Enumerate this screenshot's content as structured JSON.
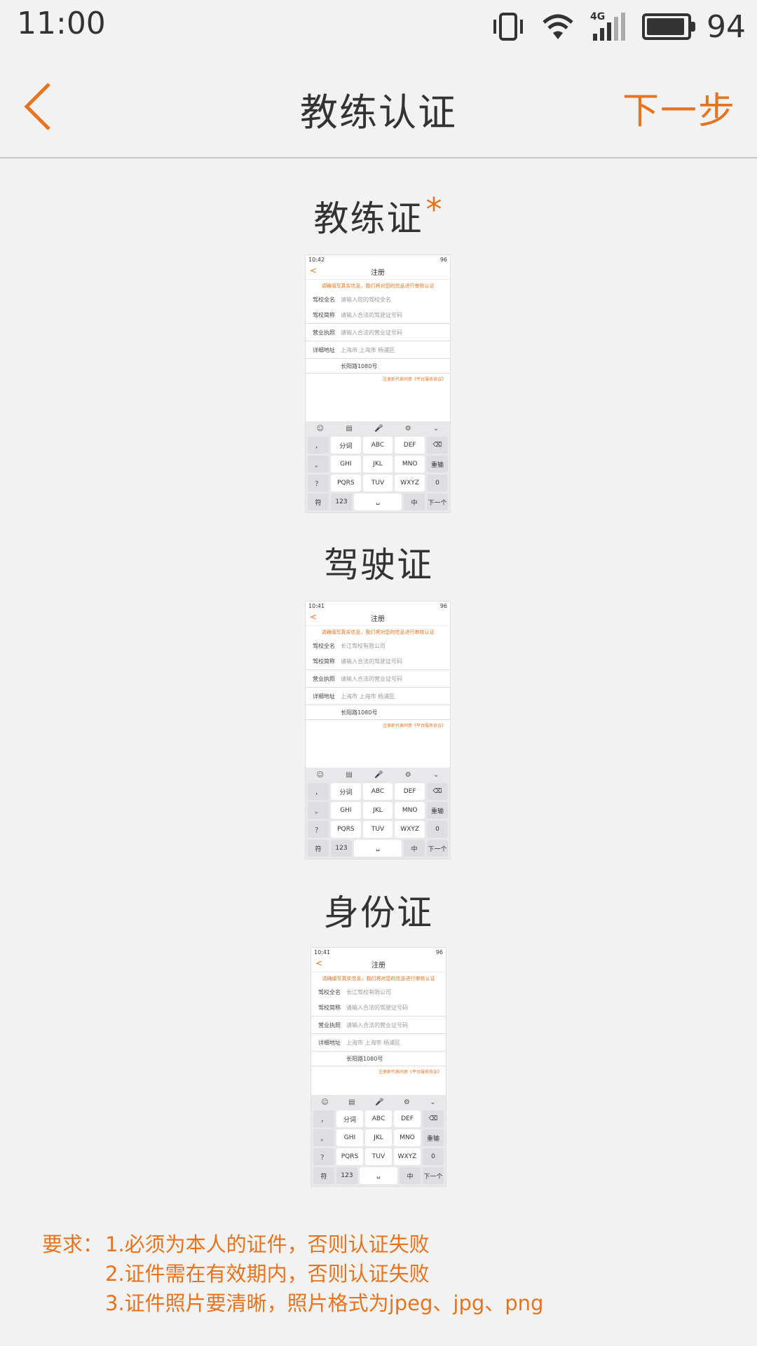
{
  "status_bar": {
    "time": "11:00",
    "network": "4G",
    "battery": "94",
    "battery_level": 0.94
  },
  "nav": {
    "title": "教练认证",
    "next_label": "下一步"
  },
  "sections": [
    {
      "title": "教练证",
      "required_mark": "*"
    },
    {
      "title": "驾驶证"
    },
    {
      "title": "身份证"
    }
  ],
  "thumbnails": [
    {
      "time": "10:42",
      "battery": "96",
      "title": "注册",
      "notice": "请确填写真实信息，我们将对您的信息进行审核认证",
      "rows": [
        {
          "label": "驾校全名",
          "value": "请输入您的驾校全名"
        },
        {
          "label": "驾校简称",
          "value": "请输入合法的驾驶证号码"
        },
        {
          "label": "营业执照",
          "value": "请输入合法的营业证号码"
        },
        {
          "label": "详细地址",
          "value": "上海市 上海市 杨浦区"
        }
      ],
      "addr2": "长阳路1080号",
      "terms": "注册即代表同意《平台服务协议》",
      "keys": {
        "top": [
          "☺",
          "▤",
          "🎤",
          "⚙",
          "⌄"
        ],
        "side": [
          "，",
          "。",
          "？",
          "！"
        ],
        "rows": [
          [
            "分词",
            "ABC",
            "DEF"
          ],
          [
            "GHI",
            "JKL",
            "MNO"
          ],
          [
            "PQRS",
            "TUV",
            "WXYZ"
          ]
        ],
        "right": [
          "⌫",
          "重输",
          "0"
        ],
        "bottom": [
          "符",
          "123",
          "␣",
          "中",
          "下一个"
        ]
      }
    },
    {
      "time": "10:41",
      "battery": "96",
      "title": "注册",
      "notice": "请确填写真实信息，我们将对您的信息进行审核认证",
      "rows": [
        {
          "label": "驾校全名",
          "value": "长江驾校有限公司"
        },
        {
          "label": "驾校简称",
          "value": "请输入合法的驾驶证号码"
        },
        {
          "label": "营业执照",
          "value": "请输入合法的营业证号码"
        },
        {
          "label": "详细地址",
          "value": "上海市 上海市 杨浦区"
        }
      ],
      "addr2": "长阳路1080号",
      "terms": "注册即代表同意《平台服务协议》",
      "keys": {
        "top": [
          "☺",
          "▤",
          "🎤",
          "⚙",
          "⌄"
        ],
        "side": [
          "，",
          "。",
          "？",
          "！"
        ],
        "rows": [
          [
            "分词",
            "ABC",
            "DEF"
          ],
          [
            "GHI",
            "JKL",
            "MNO"
          ],
          [
            "PQRS",
            "TUV",
            "WXYZ"
          ]
        ],
        "right": [
          "⌫",
          "重输",
          "0"
        ],
        "bottom": [
          "符",
          "123",
          "␣",
          "中",
          "下一个"
        ]
      }
    },
    {
      "time": "10:41",
      "battery": "96",
      "title": "注册",
      "notice": "请确填写真实信息，我们将对您的信息进行审核认证",
      "rows": [
        {
          "label": "驾校全名",
          "value": "长江驾校有限公司"
        },
        {
          "label": "驾校简称",
          "value": "请输入合法的驾驶证号码"
        },
        {
          "label": "营业执照",
          "value": "请输入合法的营业证号码"
        },
        {
          "label": "详细地址",
          "value": "上海市 上海市 杨浦区"
        }
      ],
      "addr2": "长阳路1080号",
      "terms": "注册即代表同意《平台服务协议》",
      "keys": {
        "top": [
          "☺",
          "▤",
          "🎤",
          "⚙",
          "⌄"
        ],
        "side": [
          "，",
          "。",
          "？",
          "！"
        ],
        "rows": [
          [
            "分词",
            "ABC",
            "DEF"
          ],
          [
            "GHI",
            "JKL",
            "MNO"
          ],
          [
            "PQRS",
            "TUV",
            "WXYZ"
          ]
        ],
        "right": [
          "⌫",
          "重输",
          "0"
        ],
        "bottom": [
          "符",
          "123",
          "␣",
          "中",
          "下一个"
        ]
      }
    }
  ],
  "requirements": {
    "lead": "要求：",
    "items": [
      "1.必须为本人的证件，否则认证失败",
      "2.证件需在有效期内，否则认证失败",
      "3.证件照片要清晰，照片格式为jpeg、jpg、png"
    ]
  },
  "colors": {
    "accent": "#e8731e",
    "background": "#f2f2f2",
    "text": "#333333"
  },
  "icons": {
    "back": "chevron-left-icon",
    "vibrate": "vibrate-icon",
    "wifi": "wifi-icon",
    "signal": "signal-icon",
    "battery": "battery-icon"
  }
}
